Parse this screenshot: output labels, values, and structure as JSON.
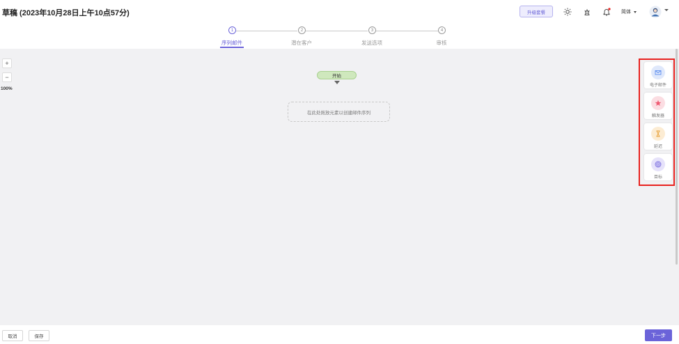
{
  "header": {
    "title": "草稿 (2023年10月28日上午10点57分)",
    "upgrade_label": "升级套餐",
    "language_label": "简体",
    "icons": [
      "sun-icon",
      "chess-icon",
      "bell-icon",
      "avatar",
      "chevron-down-icon"
    ]
  },
  "steps": [
    {
      "number": "1",
      "label": "序列邮件",
      "active": true
    },
    {
      "number": "2",
      "label": "潜在客户",
      "active": false
    },
    {
      "number": "3",
      "label": "发送选项",
      "active": false
    },
    {
      "number": "4",
      "label": "审核",
      "active": false
    }
  ],
  "canvas": {
    "zoom_in": "+",
    "zoom_out": "−",
    "zoom_level": "100%",
    "start_label": "开始",
    "dropzone_text": "在此处拖放元素以创建邮件序列"
  },
  "palette": [
    {
      "label": "电子邮件",
      "icon": "mail-icon",
      "color": "#5b8def",
      "bg": "#dfe8fb"
    },
    {
      "label": "触发器",
      "icon": "star-icon",
      "color": "#ef5a73",
      "bg": "#fbdde2"
    },
    {
      "label": "延迟",
      "icon": "hourglass-icon",
      "color": "#e8a13a",
      "bg": "#fcecd3"
    },
    {
      "label": "目标",
      "icon": "target-icon",
      "color": "#7b6ee0",
      "bg": "#e6e2fa"
    }
  ],
  "footer": {
    "cancel_label": "取消",
    "save_label": "保存",
    "next_label": "下一步"
  },
  "colors": {
    "accent": "#6b63d9",
    "highlight_box": "#e8211e"
  }
}
